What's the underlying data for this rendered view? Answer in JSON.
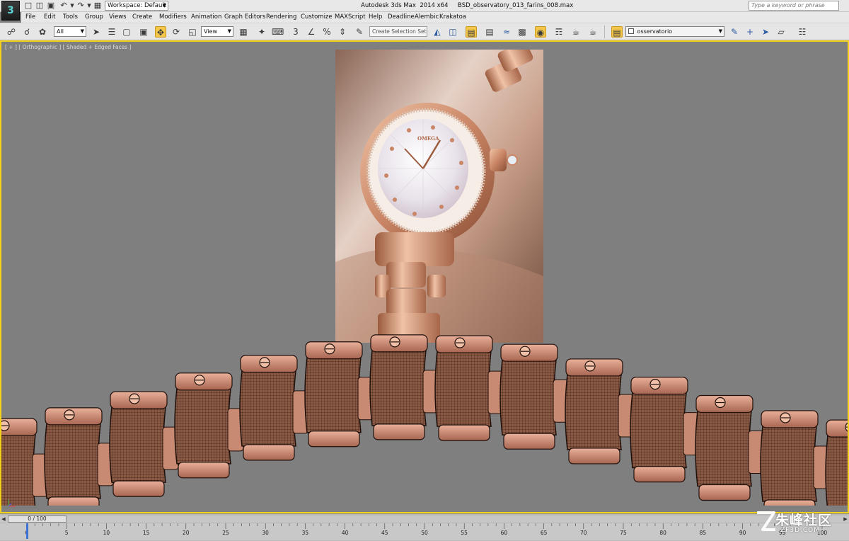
{
  "titlebar": {
    "title": "Autodesk 3ds Max  2014 x64     BSD_observatory_013_farins_008.max",
    "workspace_label": "Workspace: Default",
    "search_placeholder": "Type a keyword or phrase"
  },
  "menu": {
    "items": [
      "File",
      "Edit",
      "Tools",
      "Group",
      "Views",
      "Create",
      "Modifiers",
      "Animation",
      "Graph Editors",
      "Rendering",
      "Customize",
      "MAXScript",
      "Help",
      "Deadline",
      "Alembic",
      "Krakatoa"
    ]
  },
  "toolbar": {
    "selection_filter": "All",
    "reference_coord": "View",
    "named_selection_placeholder": "Create Selection Set",
    "layer_name": "osservatorio"
  },
  "viewport": {
    "label": "[ + ] [ Orthographic ] [ Shaded + Edged Faces ]",
    "accent_color": "#f2d21a",
    "reference_image_subject": "rose gold ladies watch with diamond bezel"
  },
  "timeline": {
    "frame_display": "0 / 100",
    "ticks": [
      "0",
      "5",
      "10",
      "15",
      "20",
      "25",
      "30",
      "35",
      "40",
      "45",
      "50",
      "55",
      "60",
      "65",
      "70",
      "75",
      "80",
      "85",
      "90",
      "95",
      "100"
    ]
  },
  "watermark": {
    "text": "朱峰社区",
    "sub": "ZF3D.COM"
  }
}
